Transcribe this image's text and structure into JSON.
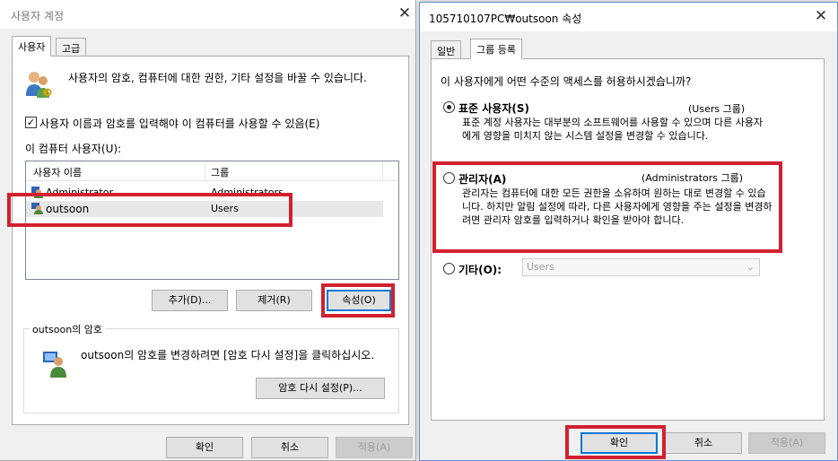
{
  "left_window": {
    "title": "사용자 계정",
    "close_glyph": "✕",
    "tabs": [
      {
        "label": "사용자"
      },
      {
        "label": "고급"
      }
    ],
    "intro_text": "사용자의 암호, 컴퓨터에 대한 권한, 기타 설정을 바꿀 수 있습니다.",
    "require_login_check": "✓",
    "require_login_label": "사용자 이름과 암호를 입력해야 이 컴퓨터를 사용할 수 있음(E)",
    "users_label": "이 컴퓨터 사용자(U):",
    "columns": [
      "사용자 이름",
      "그룹"
    ],
    "rows": [
      {
        "name": "Administrator",
        "group": "Administrators"
      },
      {
        "name": "outsoon",
        "group": "Users"
      }
    ],
    "buttons": {
      "add": "추가(D)...",
      "remove": "제거(R)",
      "properties": "속성(O)"
    },
    "password_group": {
      "label": "outsoon의 암호",
      "text": "outsoon의 암호를 변경하려면 [암호 다시 설정]을 클릭하십시오.",
      "reset_button": "암호 다시 설정(P)..."
    },
    "footer": {
      "ok": "확인",
      "cancel": "취소",
      "apply": "적용(A)"
    }
  },
  "right_window": {
    "title": "105710107PC₩outsoon 속성",
    "close_glyph": "✕",
    "tabs": [
      {
        "label": "일반"
      },
      {
        "label": "그룹 등록"
      }
    ],
    "question": "이 사용자에게 어떤 수준의 액세스를 허용하시겠습니까?",
    "options": {
      "standard": {
        "label": "표준 사용자(S)",
        "group": "(Users 그룹)",
        "desc": "표준 계정 사용자는 대부분의 소프트웨어를 사용할 수 있으며 다른 사용자에게 영향을 미치지 않는 시스템 설정을 변경할 수 있습니다."
      },
      "admin": {
        "label": "관리자(A)",
        "group": "(Administrators 그룹)",
        "desc": "관리자는 컴퓨터에 대한 모든 권한을 소유하며 원하는 대로 변경할 수 있습니다. 하지만 알림 설정에 따라, 다른 사용자에게 영향을 주는 설정을 변경하려면 관리자 암호를 입력하거나 확인을 받아야 합니다."
      },
      "other": {
        "label": "기타(O):",
        "combo_value": "Users"
      }
    },
    "footer": {
      "ok": "확인",
      "cancel": "취소",
      "apply": "적용(A)"
    }
  },
  "colors": {
    "highlight_red": "#d2202f",
    "focus_blue": "#0078d7"
  }
}
